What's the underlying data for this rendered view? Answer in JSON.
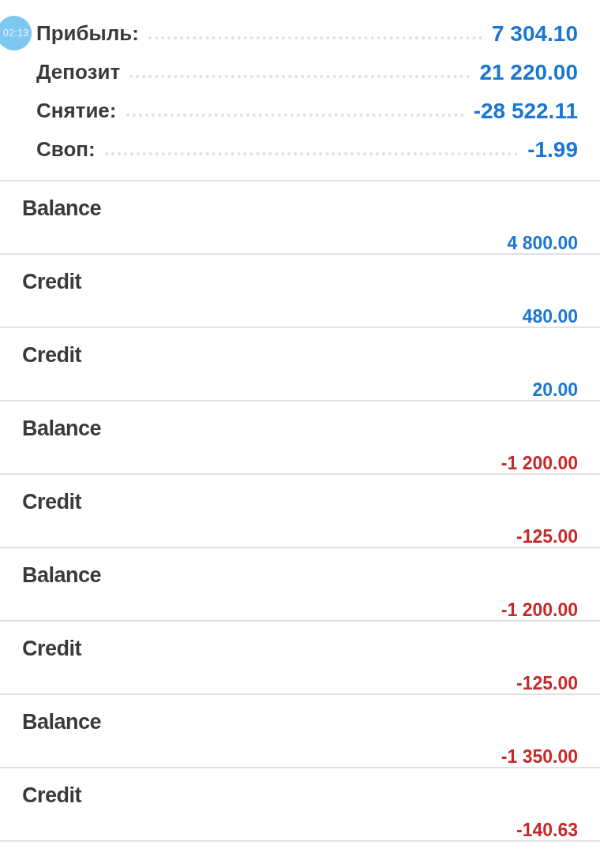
{
  "timer_bubble": {
    "text": "02:13"
  },
  "summary": [
    {
      "label": "Прибыль:",
      "value": "7 304.10"
    },
    {
      "label": "Депозит",
      "value": "21 220.00"
    },
    {
      "label": "Снятие:",
      "value": "-28 522.11"
    },
    {
      "label": "Своп:",
      "value": "-1.99"
    }
  ],
  "deals": [
    {
      "type": "Balance",
      "amount": "4 800.00",
      "color": "#1976d2"
    },
    {
      "type": "Credit",
      "amount": "480.00",
      "color": "#1976d2"
    },
    {
      "type": "Credit",
      "amount": "20.00",
      "color": "#1976d2"
    },
    {
      "type": "Balance",
      "amount": "-1 200.00",
      "color": "#c62828"
    },
    {
      "type": "Credit",
      "amount": "-125.00",
      "color": "#c62828"
    },
    {
      "type": "Balance",
      "amount": "-1 200.00",
      "color": "#c62828"
    },
    {
      "type": "Credit",
      "amount": "-125.00",
      "color": "#c62828"
    },
    {
      "type": "Balance",
      "amount": "-1 350.00",
      "color": "#c62828"
    },
    {
      "type": "Credit",
      "amount": "-140.63",
      "color": "#c62828"
    }
  ]
}
